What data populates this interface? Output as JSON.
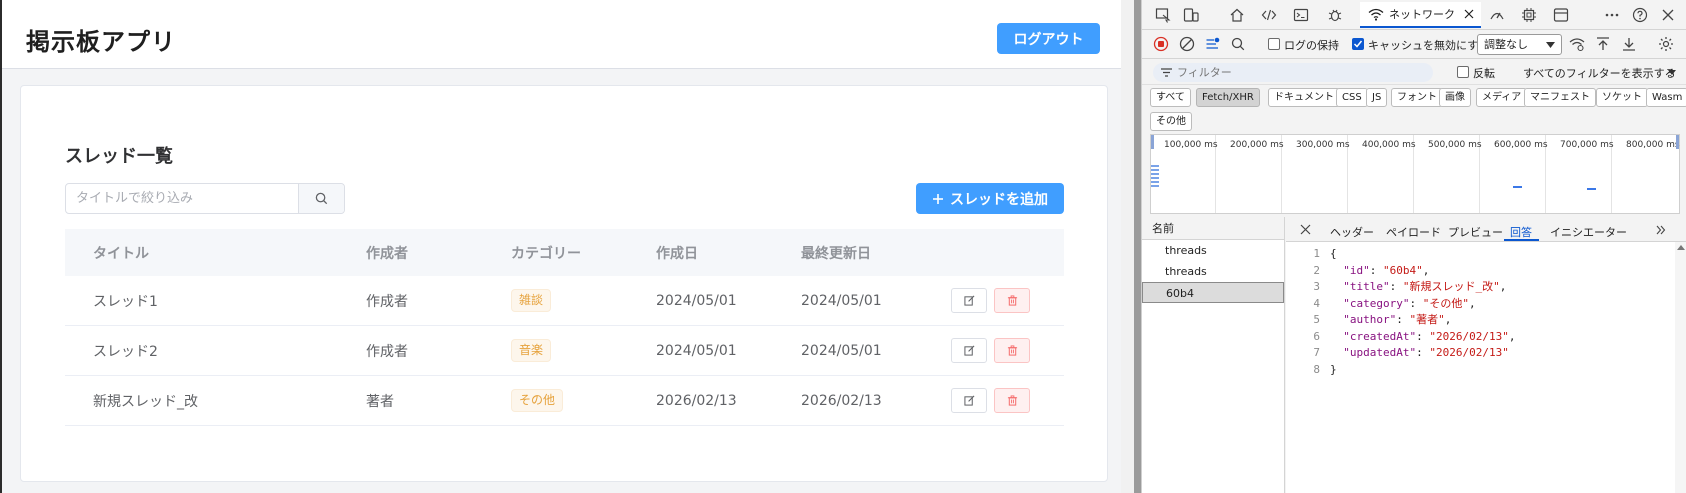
{
  "app": {
    "title": "掲示板アプリ",
    "logout_label": "ログアウト",
    "section_title": "スレッド一覧",
    "search_placeholder": "タイトルで絞り込み",
    "add_thread_label": "スレッドを追加",
    "columns": [
      "タイトル",
      "作成者",
      "カテゴリー",
      "作成日",
      "最終更新日"
    ],
    "rows": [
      {
        "title": "スレッド1",
        "author": "作成者",
        "category": "雑談",
        "created": "2024/05/01",
        "updated": "2024/05/01"
      },
      {
        "title": "スレッド2",
        "author": "作成者",
        "category": "音楽",
        "created": "2024/05/01",
        "updated": "2024/05/01"
      },
      {
        "title": "新規スレッド_改",
        "author": "著者",
        "category": "その他",
        "created": "2026/02/13",
        "updated": "2026/02/13"
      }
    ],
    "colors": {
      "primary": "#409eff",
      "danger": "#f56c6c",
      "warning": "#e6a23c"
    }
  },
  "devtools": {
    "network_tab_label": "ネットワーク",
    "toolbar": {
      "preserve_log": "ログの保持",
      "disable_cache": "キャッシュを無効にする",
      "throttle": "調整なし"
    },
    "filter_placeholder": "フィルター",
    "invert_label": "反転",
    "show_all_filters": "すべてのフィルターを表示する",
    "type_filters": [
      "すべて",
      "Fetch/XHR",
      "ドキュメント",
      "CSS",
      "JS",
      "フォント",
      "画像",
      "メディア",
      "マニフェスト",
      "ソケット",
      "Wasm",
      "その他"
    ],
    "timeline_ticks": [
      "100,000 ms",
      "200,000 ms",
      "300,000 ms",
      "400,000 ms",
      "500,000 ms",
      "600,000 ms",
      "700,000 ms",
      "800,000 ms"
    ],
    "requests_header": "名前",
    "requests": [
      "threads",
      "threads",
      "60b4"
    ],
    "detail_tabs": [
      "ヘッダー",
      "ペイロード",
      "プレビュー",
      "回答",
      "イニシエーター"
    ],
    "response_lines": [
      {
        "n": "1",
        "text": "{"
      },
      {
        "n": "2",
        "key": "\"id\"",
        "val": "\"60b4\"",
        "end": ","
      },
      {
        "n": "3",
        "key": "\"title\"",
        "val": "\"新規スレッド_改\"",
        "end": ","
      },
      {
        "n": "4",
        "key": "\"category\"",
        "val": "\"その他\"",
        "end": ","
      },
      {
        "n": "5",
        "key": "\"author\"",
        "val": "\"著者\"",
        "end": ","
      },
      {
        "n": "6",
        "key": "\"createdAt\"",
        "val": "\"2026/02/13\"",
        "end": ","
      },
      {
        "n": "7",
        "key": "\"updatedAt\"",
        "val": "\"2026/02/13\"",
        "end": ""
      },
      {
        "n": "8",
        "text": "}"
      }
    ]
  }
}
